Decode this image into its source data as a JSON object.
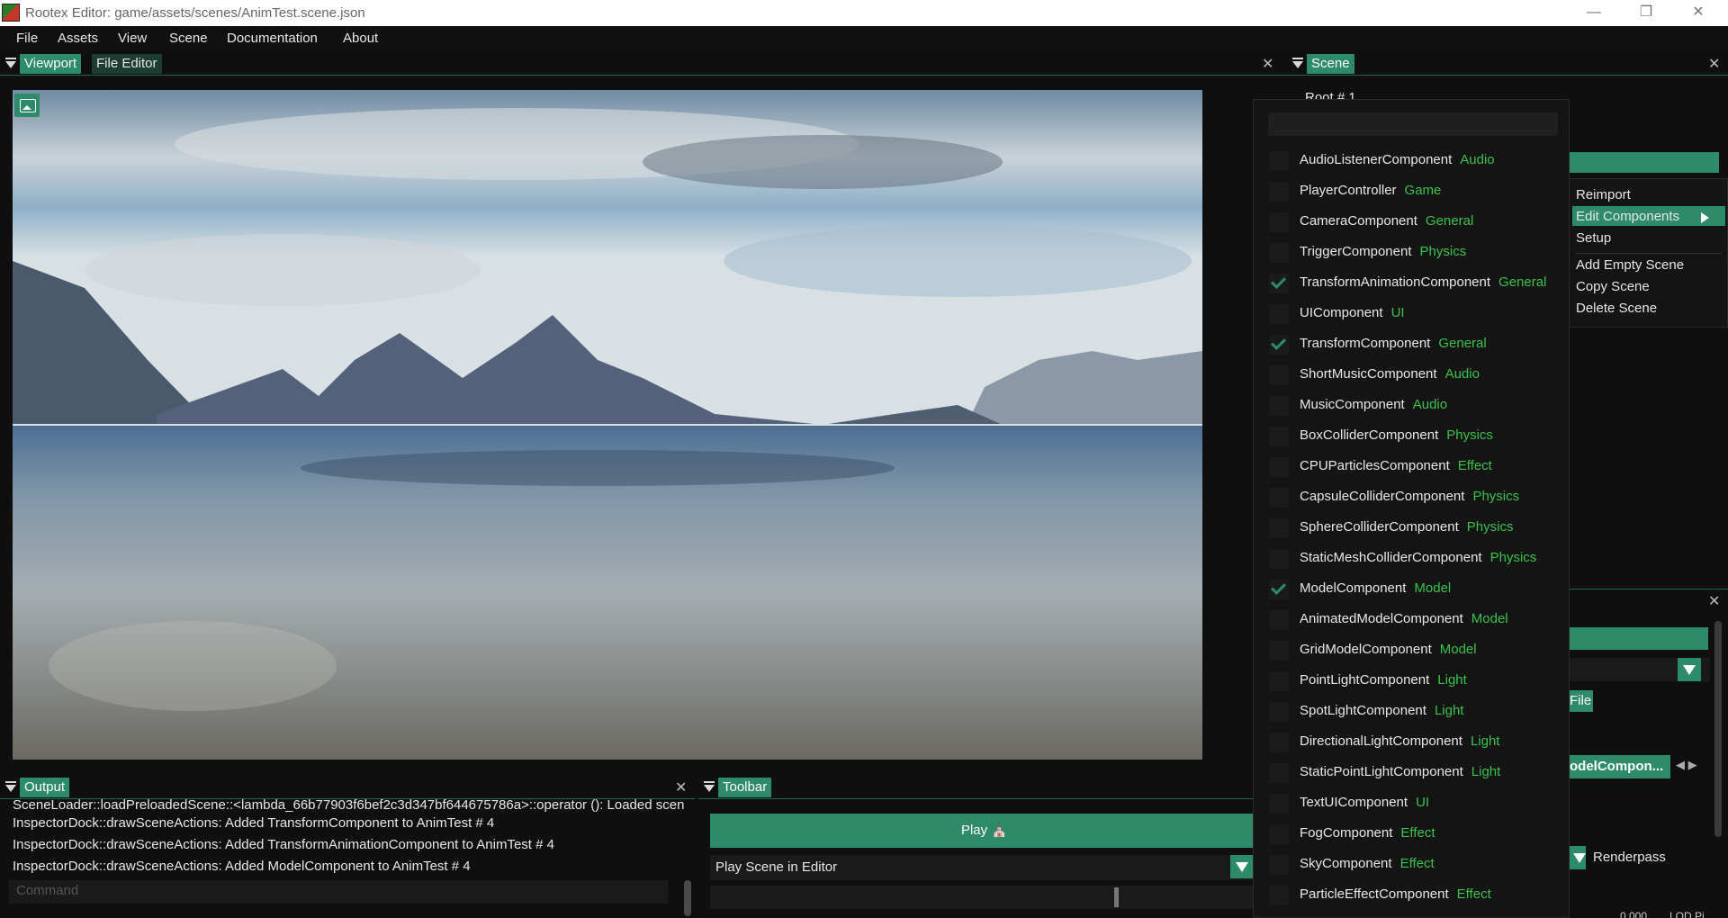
{
  "window": {
    "title": "Rootex Editor: game/assets/scenes/AnimTest.scene.json",
    "min_glyph": "—",
    "max_glyph": "❐",
    "close_glyph": "✕"
  },
  "menu": [
    "File",
    "Assets",
    "View",
    "Scene",
    "Documentation",
    "About"
  ],
  "viewport_dock": {
    "tabs": [
      "Viewport",
      "File Editor"
    ],
    "close_glyph": "✕"
  },
  "scene_dock": {
    "tab": "Scene",
    "close_glyph": "✕",
    "root_label": "Root # 1"
  },
  "context_menu": {
    "items": [
      "Reimport",
      "Edit Components",
      "Setup",
      "Add Empty Scene",
      "Copy Scene",
      "Delete Scene"
    ]
  },
  "components_popup": {
    "search_value": "",
    "items": [
      {
        "name": "AudioListenerComponent",
        "category": "Audio",
        "checked": false
      },
      {
        "name": "PlayerController",
        "category": "Game",
        "checked": false
      },
      {
        "name": "CameraComponent",
        "category": "General",
        "checked": false
      },
      {
        "name": "TriggerComponent",
        "category": "Physics",
        "checked": false
      },
      {
        "name": "TransformAnimationComponent",
        "category": "General",
        "checked": true
      },
      {
        "name": "UIComponent",
        "category": "UI",
        "checked": false
      },
      {
        "name": "TransformComponent",
        "category": "General",
        "checked": true
      },
      {
        "name": "ShortMusicComponent",
        "category": "Audio",
        "checked": false
      },
      {
        "name": "MusicComponent",
        "category": "Audio",
        "checked": false
      },
      {
        "name": "BoxColliderComponent",
        "category": "Physics",
        "checked": false
      },
      {
        "name": "CPUParticlesComponent",
        "category": "Effect",
        "checked": false
      },
      {
        "name": "CapsuleColliderComponent",
        "category": "Physics",
        "checked": false
      },
      {
        "name": "SphereColliderComponent",
        "category": "Physics",
        "checked": false
      },
      {
        "name": "StaticMeshColliderComponent",
        "category": "Physics",
        "checked": false
      },
      {
        "name": "ModelComponent",
        "category": "Model",
        "checked": true
      },
      {
        "name": "AnimatedModelComponent",
        "category": "Model",
        "checked": false
      },
      {
        "name": "GridModelComponent",
        "category": "Model",
        "checked": false
      },
      {
        "name": "PointLightComponent",
        "category": "Light",
        "checked": false
      },
      {
        "name": "SpotLightComponent",
        "category": "Light",
        "checked": false
      },
      {
        "name": "DirectionalLightComponent",
        "category": "Light",
        "checked": false
      },
      {
        "name": "StaticPointLightComponent",
        "category": "Light",
        "checked": false
      },
      {
        "name": "TextUIComponent",
        "category": "UI",
        "checked": false
      },
      {
        "name": "FogComponent",
        "category": "Effect",
        "checked": false
      },
      {
        "name": "SkyComponent",
        "category": "Effect",
        "checked": false
      },
      {
        "name": "ParticleEffectComponent",
        "category": "Effect",
        "checked": false
      }
    ]
  },
  "output_dock": {
    "tab": "Output",
    "close_glyph": "✕",
    "lines": [
      "SceneLoader::loadPreloadedScene::<lambda_66b77903f6bef2c3d347bf64467578​6a>::operator (): Loaded scene",
      "InspectorDock::drawSceneActions: Added TransformComponent to AnimTest # 4",
      "InspectorDock::drawSceneActions: Added TransformAnimationComponent to AnimTest # 4",
      "InspectorDock::drawSceneActions: Added ModelComponent to AnimTest # 4"
    ],
    "command_placeholder": "Command"
  },
  "toolbar_dock": {
    "tab": "Toolbar",
    "play_label": "Play",
    "play_icon": "⛪",
    "play_scene_combo": "Play Scene in Editor"
  },
  "inspector": {
    "close_glyph": "✕",
    "file_button": "File",
    "component_tab": "odelCompon...",
    "nav_arrows": "◀ ▶",
    "renderpass_label": "Renderpass",
    "bottom_value": "0.000",
    "bottom_label": "LOD Pi..."
  },
  "colors": {
    "accent": "#2e8b6a",
    "category": "#39c24a",
    "background": "#0f0f0f"
  }
}
